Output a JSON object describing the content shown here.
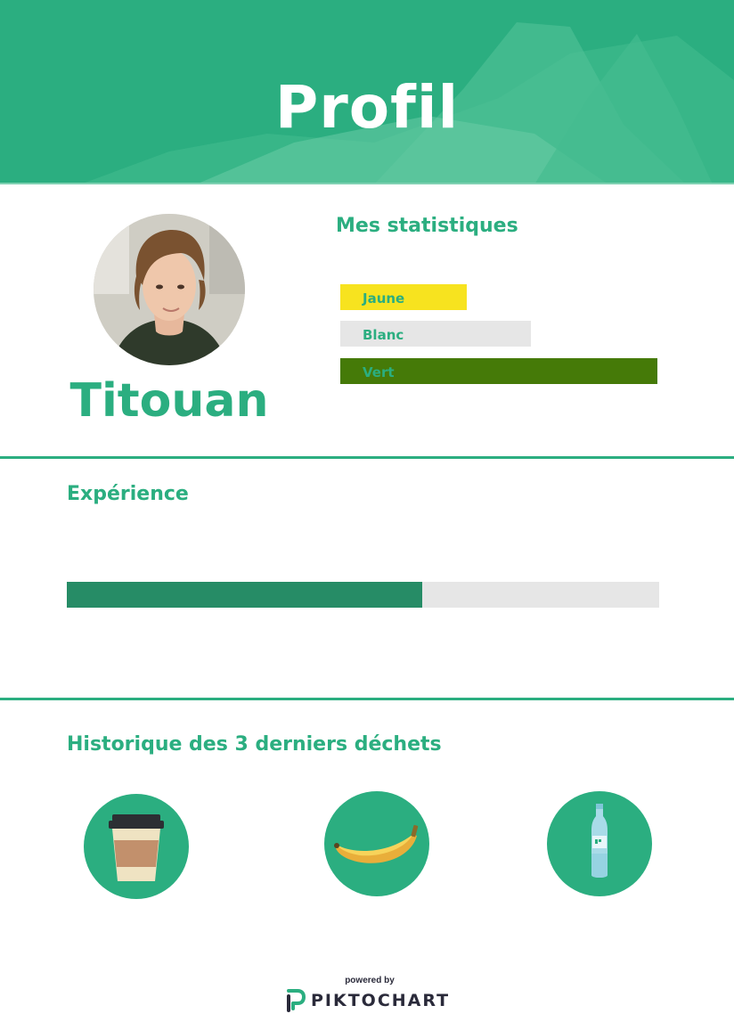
{
  "header": {
    "title": "Profil"
  },
  "profile": {
    "name": "Titouan"
  },
  "stats": {
    "title": "Mes statistiques",
    "bars": [
      {
        "label": "Jaune",
        "color": "#f7e31f",
        "fraction": 0.4
      },
      {
        "label": "Blanc",
        "color": "#e6e6e6",
        "fraction": 0.6
      },
      {
        "label": "Vert",
        "color": "#457a08",
        "fraction": 1.0
      }
    ]
  },
  "experience": {
    "title": "Expérience",
    "progress": 0.6
  },
  "history": {
    "title": "Historique des 3 derniers déchets",
    "items": [
      {
        "icon": "coffee-cup-icon"
      },
      {
        "icon": "banana-icon"
      },
      {
        "icon": "water-bottle-icon"
      }
    ]
  },
  "footer": {
    "powered_by": "powered by",
    "brand": "PIKTOCHART"
  },
  "colors": {
    "primary": "#2bae80",
    "dark_green": "#268c66"
  }
}
